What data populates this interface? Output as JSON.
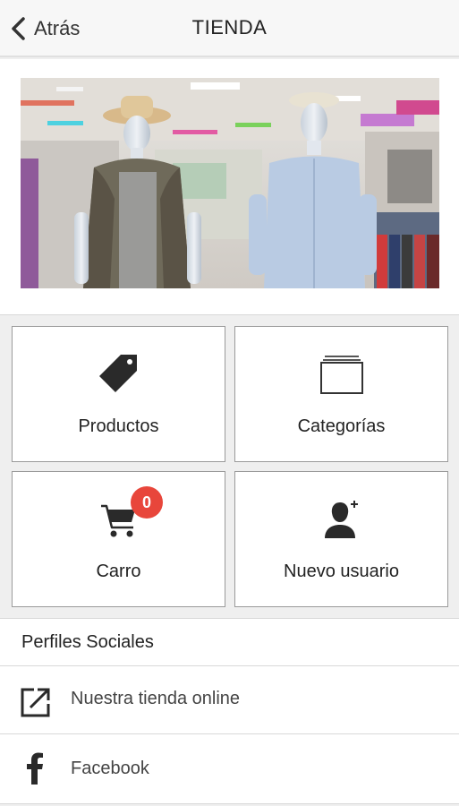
{
  "header": {
    "back_label": "Atrás",
    "title": "TIENDA"
  },
  "banner": {
    "image_alt": "Escaparate de tienda con maniquíes vistiendo camisas y sombreros"
  },
  "tiles": [
    {
      "label": "Productos",
      "icon": "tag-icon"
    },
    {
      "label": "Categorías",
      "icon": "folder-stack-icon"
    },
    {
      "label": "Carro",
      "icon": "shopping-cart-icon",
      "badge": "0"
    },
    {
      "label": "Nuevo usuario",
      "icon": "add-user-icon"
    }
  ],
  "social": {
    "heading": "Perfiles Sociales",
    "items": [
      {
        "label": "Nuestra tienda online",
        "icon": "external-link-icon"
      },
      {
        "label": "Facebook",
        "icon": "facebook-icon"
      }
    ]
  },
  "colors": {
    "badge": "#e8463b",
    "tile_border": "#9a9a9a",
    "background": "#efefef"
  }
}
